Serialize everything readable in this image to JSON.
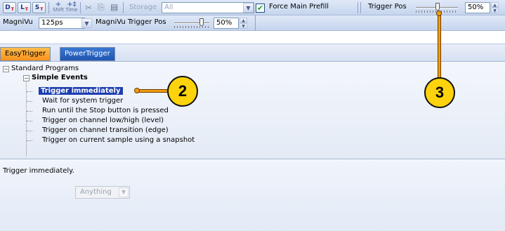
{
  "toolbar": {
    "btn_d": "D",
    "btn_l": "L",
    "btn_s": "S",
    "btn_sub": "T",
    "add_label_1": "Shift",
    "add_label_2": "Time",
    "storage_label": "Storage",
    "storage_value": "All",
    "force_main_prefill": "Force Main Prefill",
    "force_main_prefill_checked": true,
    "trigger_pos_label": "Trigger Pos",
    "trigger_pos_value": "50%",
    "magnivu_label": "MagniVu",
    "magnivu_value": "125ps",
    "magnivu_trigger_pos_label": "MagniVu Trigger Pos",
    "magnivu_trigger_pos_value": "50%"
  },
  "tabs": [
    {
      "label": "EasyTrigger",
      "active": true
    },
    {
      "label": "PowerTrigger",
      "active": false
    }
  ],
  "tree": {
    "root": "Standard Programs",
    "group": "Simple Events",
    "items": [
      "Trigger immediately",
      "Wait for system trigger",
      "Run until the Stop button is pressed",
      "Trigger on channel low/high (level)",
      "Trigger on channel transition (edge)",
      "Trigger on current sample using a snapshot"
    ],
    "selected_index": 0
  },
  "description": {
    "text": "Trigger immediately.",
    "combo_value": "Anything"
  },
  "callouts": {
    "c2": "2",
    "c3": "3"
  },
  "colors": {
    "accent_tab": "#f7931d",
    "inactive_tab": "#2056b1",
    "selection": "#1d3fae",
    "callout_fill": "#fcd30c",
    "callout_line": "#f29b12"
  }
}
